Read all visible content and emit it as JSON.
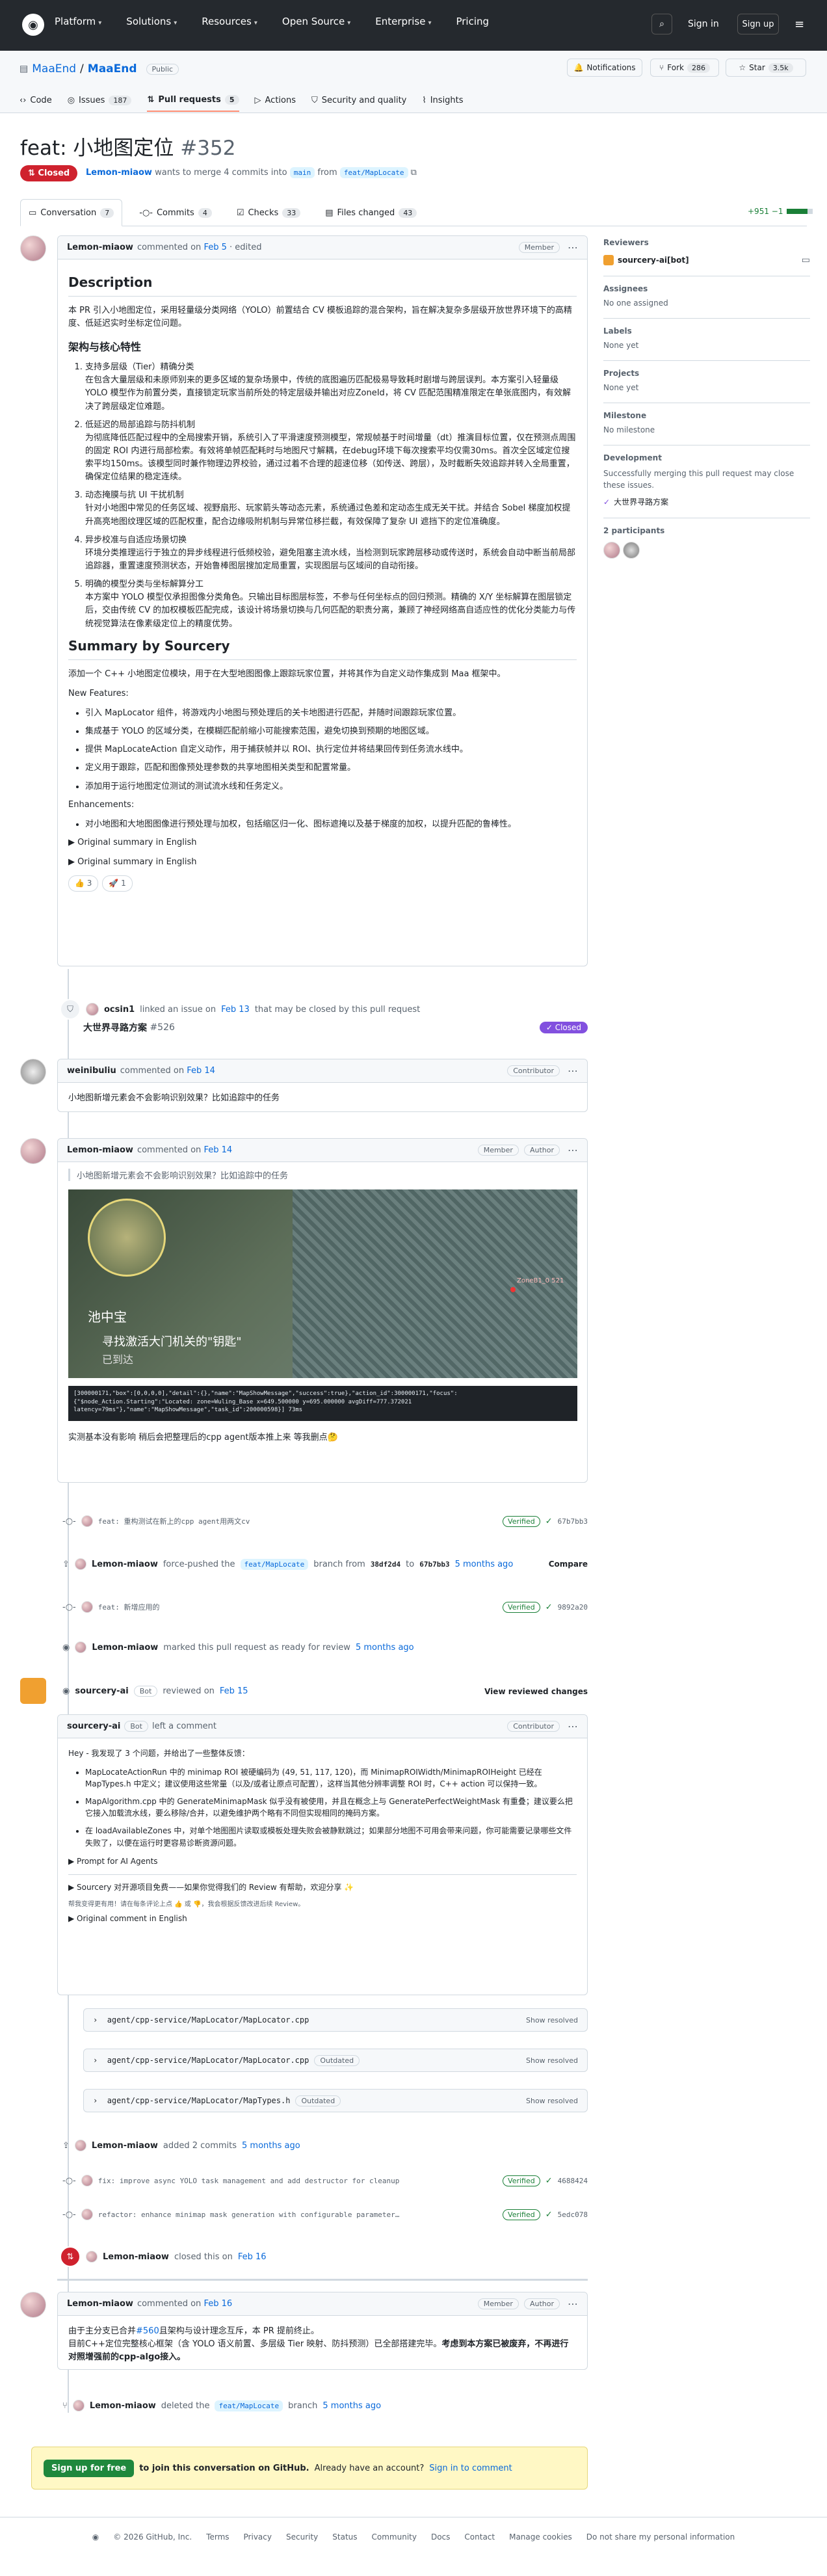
{
  "nav": {
    "items": [
      "Platform",
      "Solutions",
      "Resources",
      "Open Source",
      "Enterprise",
      "Pricing"
    ],
    "sign_in": "Sign in",
    "sign_up": "Sign up"
  },
  "repo": {
    "owner": "MaaEnd",
    "name": "MaaEnd",
    "visibility": "Public",
    "notifications": "Notifications",
    "fork": "Fork",
    "fork_count": "286",
    "star": "Star",
    "star_count": "3.5k",
    "tabs": [
      {
        "label": "Code"
      },
      {
        "label": "Issues",
        "count": "187"
      },
      {
        "label": "Pull requests",
        "count": "5"
      },
      {
        "label": "Actions"
      },
      {
        "label": "Security and quality"
      },
      {
        "label": "Insights"
      }
    ]
  },
  "pr": {
    "title": "feat: 小地图定位",
    "number": "#352",
    "status": "Closed",
    "author": "Lemon-miaow",
    "summary_mid": "wants to merge 4 commits into",
    "base": "main",
    "from": "from",
    "head": "feat/MapLocate",
    "tabs": [
      {
        "label": "Conversation",
        "count": "7"
      },
      {
        "label": "Commits",
        "count": "4"
      },
      {
        "label": "Checks",
        "count": "33"
      },
      {
        "label": "Files changed",
        "count": "43"
      }
    ],
    "diffstat": "+951 −1"
  },
  "sidebar": {
    "reviewers_label": "Reviewers",
    "reviewer": "sourcery-ai[bot]",
    "assignees_label": "Assignees",
    "assignees": "No one assigned",
    "labels_label": "Labels",
    "labels": "None yet",
    "projects_label": "Projects",
    "projects": "None yet",
    "milestone_label": "Milestone",
    "milestone": "No milestone",
    "dev_label": "Development",
    "dev_text": "Successfully merging this pull request may close these issues.",
    "dev_issue": "大世界寻路方案",
    "participants_label": "2 participants"
  },
  "c1": {
    "author": "Lemon-miaow",
    "action": "commented on",
    "date": "Feb 5",
    "edited": "· edited",
    "role": "Member",
    "h_desc": "Description",
    "desc": "本 PR 引入小地图定位，采用轻量级分类网络（YOLO）前置结合 CV 模板追踪的混合架构，旨在解决复杂多层级开放世界环境下的高精度、低延迟实时坐标定位问题。",
    "h_arch": "架构与核心特性",
    "items": [
      {
        "t": "支持多层级（Tier）精确分类",
        "d": "在包含大量层级和未原师别来的更多区域的复杂场景中，传统的底图遍历匹配极易导致耗时剧增与跨层误判。本方案引入轻量级 YOLO 模型作为前置分类，直接锁定玩家当前所处的特定层级并输出对应ZoneId，将 CV 匹配范围精准限定在单张底图内，有效解决了跨层级定位难题。"
      },
      {
        "t": "低延迟的局部追踪与防抖机制",
        "d": "为彻底降低匹配过程中的全局搜索开销，系统引入了平滑速度预测模型，常规帧基于时间增量（dt）推演目标位置，仅在预测点周围的固定 ROI 内进行局部检索。有效将单帧匹配耗时与地图尺寸解耦，在debug环境下每次搜索平均仅需30ms。首次全区域定位搜索平均150ms。该模型同时兼作物理边界校验，通过过着不合理的超速位移（如传送、跨层），及时截断失效追踪并转入全局重置，确保定位结果的稳定连续。"
      },
      {
        "t": "动态掩膜与抗 UI 干扰机制",
        "d": "针对小地图中常见的任务区域、视野扇形、玩家箭头等动态元素，系统通过色差和定动态生成无关干扰。并结合 Sobel 梯度加权提升高亮地图纹理区域的匹配权重，配合边缘吸附机制与异常位移拦截，有效保障了复杂 UI 遮挡下的定位准确度。"
      },
      {
        "t": "异步校准与自适应场景切换",
        "d": "环境分类推理运行于独立的异步线程进行低频校验，避免阻塞主流水线，当检测到玩家跨层移动或传送时，系统会自动中断当前局部追踪器，重置速度预测状态，开始鲁棒图层搜加定局重置，实现图层与区域间的自动衔接。"
      },
      {
        "t": "明确的模型分类与坐标解算分工",
        "d": "本方案中 YOLO 模型仅承担图像分类角色。只输出目标图层标签，不参与任何坐标点的回归预测。精确的 X/Y 坐标解算在图层锁定后，交由传统 CV 的加权模板匹配完成，该设计将场景切换与几何匹配的职责分离，兼顾了神经网络高自适应性的优化分类能力与传统视觉算法在像素级定位上的精度优势。"
      }
    ],
    "h_sum": "Summary by Sourcery",
    "sum": "添加一个 C++ 小地图定位模块，用于在大型地图图像上跟踪玩家位置，并将其作为自定义动作集成到 Maa 框架中。",
    "nf_label": "New Features:",
    "nf": [
      "引入 MapLocator 组件，将游戏内小地图与预处理后的关卡地图进行匹配，并随时间跟踪玩家位置。",
      "集成基于 YOLO 的区域分类，在模糊匹配前缩小可能搜索范围，避免切换到预期的地图区域。",
      "提供 MapLocateAction 自定义动作，用于捕获帧并以 ROI、执行定位并将结果回传到任务流水线中。",
      "定义用于跟踪，匹配和图像预处理参数的共享地图相关类型和配置常量。",
      "添加用于运行地图定位测试的测试流水线和任务定义。"
    ],
    "enh_label": "Enhancements:",
    "enh": [
      "对小地图和大地图图像进行预处理与加权，包括缩区归一化、图标遮掩以及基于梯度的加权，以提升匹配的鲁棒性。"
    ],
    "orig1": "▶ Original summary in English",
    "orig2": "▶ Original summary in English",
    "react1": "👍 3",
    "react2": "🚀 1"
  },
  "link": {
    "user": "ocsin1",
    "text": "linked an issue on",
    "date": "Feb 13",
    "rest": "that may be closed by this pull request",
    "issue": "大世界寻路方案",
    "issue_num": "#526",
    "state": "Closed"
  },
  "c2": {
    "author": "weinibuliu",
    "action": "commented on",
    "date": "Feb 14",
    "role": "Contributor",
    "text": "小地图新增元素会不会影响识别效果？比如追踪中的任务"
  },
  "c3": {
    "author": "Lemon-miaow",
    "action": "commented on",
    "date": "Feb 14",
    "role": "Member",
    "role2": "Author",
    "quote": "小地图新增元素会不会影响识别效果？比如追踪中的任务",
    "game_poi": "池中宝",
    "game_task1": "寻找激活大门机关的\"钥匙\"",
    "game_task2": "已到达",
    "game_coord": "ZoneB1_0 521",
    "log": "[300000171,\"box\":[0,0,0,0],\"detail\":{},\"name\":\"MapShowMessage\",\"success\":true},\"action_id\":300000171,\"focus\":{\"$node_Action.Starting\":\"Located: zone=Wuling_Base x=649.500000 y=695.000000 avgDiff=777.372021 latency=79ms\"},\"name\":\"MapShowMessage\",\"task_id\":200000598}] 73ms",
    "text": "实测基本没有影响 稍后会把整理后的cpp agent版本推上来 等我删点🤔"
  },
  "commits1": [
    {
      "msg": "feat: 重构测试在新上的cpp agent用两文cv",
      "verified": "Verified",
      "sha": "67b7bb3"
    }
  ],
  "push": {
    "user": "Lemon-miaow",
    "text": "force-pushed the",
    "branch": "feat/MapLocate",
    "from": "branch from",
    "old": "38df2d4",
    "to": "to",
    "new": "67b7bb3",
    "ago": "5 months ago",
    "compare": "Compare"
  },
  "commits2": [
    {
      "msg": "feat: 新增应用的",
      "verified": "Verified",
      "sha": "9892a20"
    }
  ],
  "ready": {
    "user": "Lemon-miaow",
    "text": "marked this pull request as ready for review",
    "ago": "5 months ago"
  },
  "review": {
    "user": "sourcery-ai",
    "bot": "Bot",
    "text": "reviewed on",
    "date": "Feb 15",
    "btn": "View reviewed changes"
  },
  "c4": {
    "author": "sourcery-ai",
    "bot": "Bot",
    "action": "left a comment",
    "role": "Contributor",
    "intro": "Hey - 我发现了 3 个问题，并给出了一些整体反馈：",
    "points": [
      "MapLocateActionRun 中的 minimap ROI 被硬编码为 (49, 51, 117, 120)，而 MinimapROIWidth/MinimapROIHeight 已经在 MapTypes.h 中定义；建议使用这些常量（以及/或者让原点可配置），这样当其他分辨率调整 ROI 时，C++ action 可以保持一致。",
      "MapAlgorithm.cpp 中的 GenerateMinimapMask 似乎没有被使用，并且在概念上与 GeneratePerfectWeightMask 有重叠；建议要么把它接入加载流水线，要么移除/合并，以避免维护两个略有不同但实现相同的掩码方案。",
      "在 loadAvailableZones 中，对单个地图图片读取或模板处理失败会被静默跳过；如果部分地图不可用会带来问题，你可能需要记录哪些文件失败了，以便在运行时更容易诊断资源问题。"
    ],
    "prompt": "▶ Prompt for AI Agents",
    "thanks": "▶ Sourcery 对开源项目免费——如果你觉得我们的 Review 有帮助，欢迎分享 ✨",
    "help": "帮我变得更有用！请在每条评论上点 👍 或 👎，我会根据反馈改进后续 Review。",
    "orig": "▶ Original comment in English",
    "files": [
      {
        "path": "agent/cpp-service/MapLocator/MapLocator.cpp",
        "tag": "",
        "show": "Show resolved"
      },
      {
        "path": "agent/cpp-service/MapLocator/MapLocator.cpp",
        "tag": "Outdated",
        "show": "Show resolved"
      },
      {
        "path": "agent/cpp-service/MapLocator/MapTypes.h",
        "tag": "Outdated",
        "show": "Show resolved"
      }
    ]
  },
  "added": {
    "user": "Lemon-miaow",
    "text": "added 2 commits",
    "ago": "5 months ago"
  },
  "commits3": [
    {
      "msg": "fix: improve async YOLO task management and add destructor for cleanup",
      "verified": "Verified",
      "sha": "4688424"
    },
    {
      "msg": "refactor: enhance minimap mask generation with configurable parameter…",
      "verified": "Verified",
      "sha": "5edc078"
    }
  ],
  "closed": {
    "user": "Lemon-miaow",
    "text": "closed this on",
    "date": "Feb 16"
  },
  "c5": {
    "author": "Lemon-miaow",
    "action": "commented on",
    "date": "Feb 16",
    "role": "Member",
    "role2": "Author",
    "l1a": "由于主分支已合并",
    "l1b": "#560",
    "l1c": "且架构与设计理念互斥，本 PR 提前终止。",
    "l2a": "目前C++定位完整核心框架（含 YOLO 语义前置、多层级 Tier 映射、防抖预测）已全部搭建完毕。",
    "l2b": "考虑到本方案已被废弃，不再进行对照增强前的cpp-algo接入。"
  },
  "deleted": {
    "user": "Lemon-miaow",
    "text": "deleted the",
    "branch": "feat/MapLocate",
    "tail": "branch",
    "ago": "5 months ago"
  },
  "join": {
    "btn": "Sign up for free",
    "text": "to join this conversation on GitHub.",
    "already": "Already have an account?",
    "signin": "Sign in to comment"
  },
  "footer": {
    "copy": "© 2026 GitHub, Inc.",
    "links": [
      "Terms",
      "Privacy",
      "Security",
      "Status",
      "Community",
      "Docs",
      "Contact",
      "Manage cookies",
      "Do not share my personal information"
    ]
  }
}
